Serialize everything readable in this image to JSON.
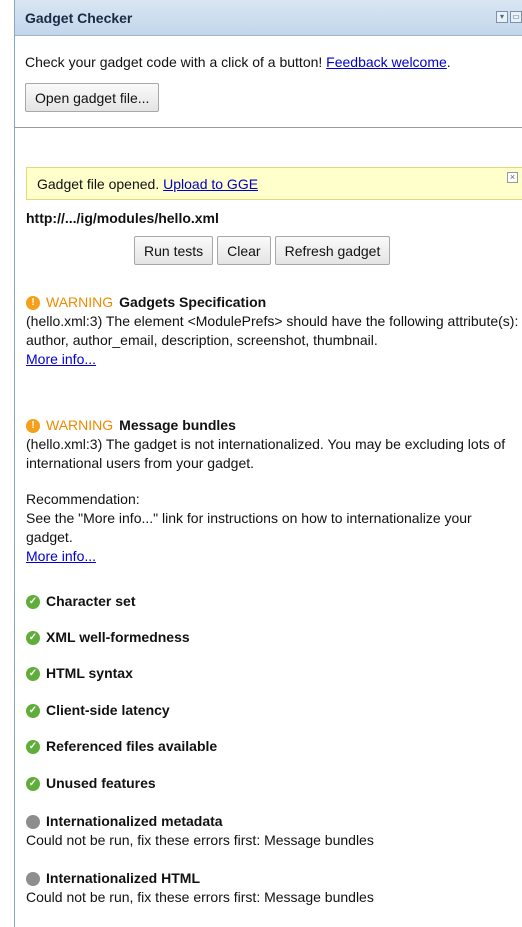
{
  "window": {
    "title": "Gadget Checker"
  },
  "intro": {
    "text": "Check your gadget code with a click of a button!",
    "link": "Feedback welcome"
  },
  "open_button": "Open gadget file...",
  "notice": {
    "text": "Gadget file opened.",
    "link": "Upload to GGE"
  },
  "file_url": "http://.../ig/modules/hello.xml",
  "actions": {
    "run": "Run tests",
    "clear": "Clear",
    "refresh": "Refresh gadget"
  },
  "warning_label": "WARNING",
  "results": {
    "spec": {
      "title": "Gadgets Specification",
      "message": "(hello.xml:3) The element <ModulePrefs> should have the following attribute(s): author, author_email, description, screenshot, thumbnail.",
      "link": "More info..."
    },
    "bundles": {
      "title": "Message bundles",
      "message": "(hello.xml:3) The gadget is not internationalized. You may be excluding lots of international users from your gadget.",
      "rec_label": "Recommendation:",
      "rec_text": "See the \"More info...\" link for instructions on how to internationalize your gadget.",
      "link": "More info..."
    },
    "passed": [
      "Character set",
      "XML well-formedness",
      "HTML syntax",
      "Client-side latency",
      "Referenced files available",
      "Unused features"
    ],
    "i18n_metadata": {
      "title": "Internationalized metadata",
      "message": "Could not be run, fix these errors first: Message bundles"
    },
    "i18n_html": {
      "title": "Internationalized HTML",
      "message": "Could not be run, fix these errors first: Message bundles"
    }
  },
  "colors": {
    "warning": "#f08a00",
    "ok": "#5fae3a",
    "na": "#8e8e8e",
    "link": "#0000cc",
    "notice_bg": "#ffffcc"
  }
}
